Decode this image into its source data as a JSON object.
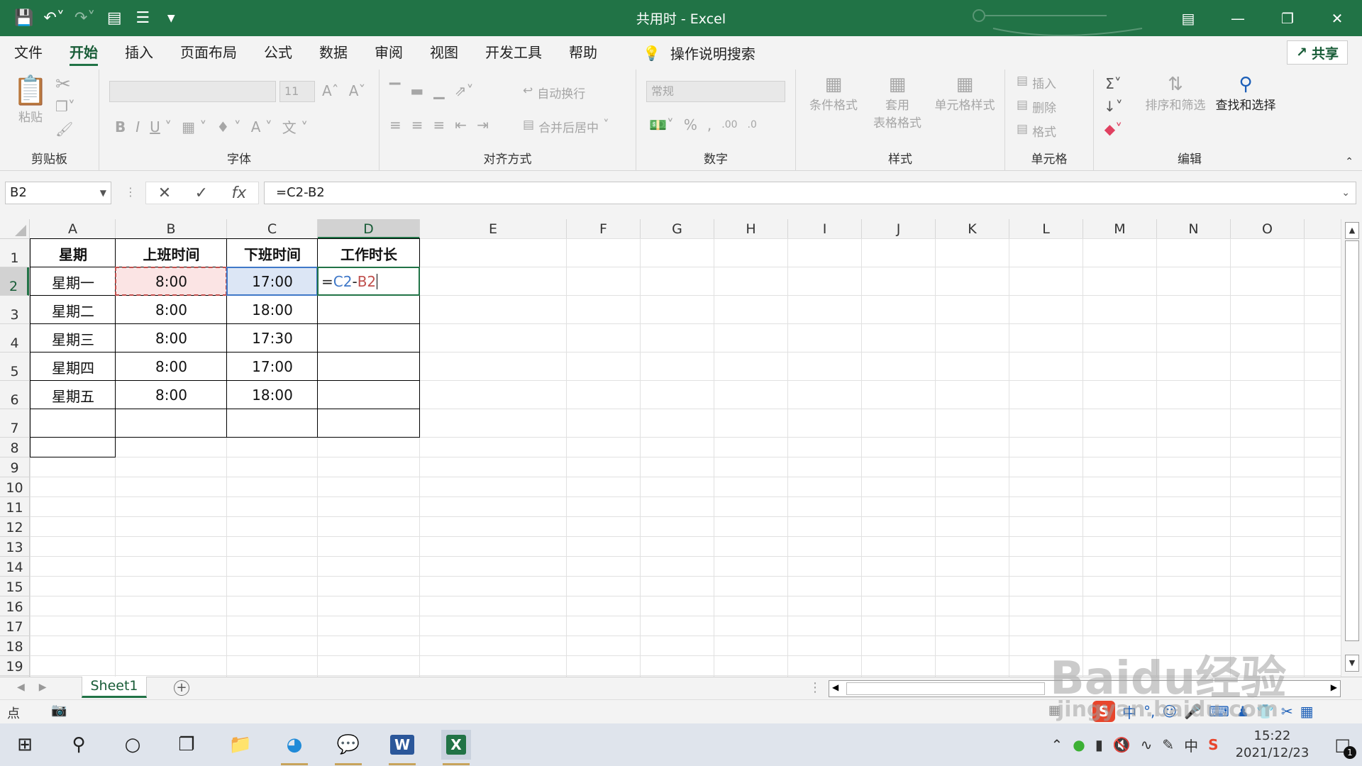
{
  "titlebar": {
    "title": "共用时  -  Excel",
    "qat_icons": [
      "save-icon",
      "undo-icon",
      "redo-icon",
      "form-icon",
      "align-icon",
      "customize-icon"
    ],
    "win_buttons": [
      "ribbon-display-icon",
      "minimize-icon",
      "restore-icon",
      "close-icon"
    ]
  },
  "menu": {
    "tabs": [
      "文件",
      "开始",
      "插入",
      "页面布局",
      "公式",
      "数据",
      "审阅",
      "视图",
      "开发工具",
      "帮助"
    ],
    "active_tab": "开始",
    "search_label": "操作说明搜索",
    "share_label": "共享"
  },
  "ribbon": {
    "clipboard": {
      "paste": "粘贴",
      "label": "剪贴板"
    },
    "font": {
      "font_name": "",
      "font_size": "11",
      "label": "字体"
    },
    "alignment": {
      "wrap": "自动换行",
      "merge": "合并后居中",
      "label": "对齐方式"
    },
    "number": {
      "format": "常规",
      "label": "数字"
    },
    "styles": {
      "conditional": "条件格式",
      "table_line1": "套用",
      "table_line2": "表格格式",
      "cell_styles": "单元格样式",
      "label": "样式"
    },
    "cells": {
      "insert": "插入",
      "delete": "删除",
      "format": "格式",
      "label": "单元格"
    },
    "editing": {
      "sort": "排序和筛选",
      "find": "查找和选择",
      "label": "编辑"
    }
  },
  "formula_bar": {
    "name_box": "B2",
    "formula": "=C2-B2"
  },
  "sheet": {
    "columns": [
      "A",
      "B",
      "C",
      "D",
      "E",
      "F",
      "G",
      "H",
      "I",
      "J",
      "K",
      "L",
      "M",
      "N",
      "O"
    ],
    "rows": [
      "1",
      "2",
      "3",
      "4",
      "5",
      "6",
      "7",
      "8",
      "9",
      "10",
      "11",
      "12",
      "13",
      "14",
      "15",
      "16",
      "17",
      "18",
      "19"
    ],
    "selected_column": "D",
    "selected_row": "2",
    "headers": [
      "星期",
      "上班时间",
      "下班时间",
      "工作时长"
    ],
    "data": [
      [
        "星期一",
        "8:00",
        "17:00",
        ""
      ],
      [
        "星期二",
        "8:00",
        "18:00",
        ""
      ],
      [
        "星期三",
        "8:00",
        "17:30",
        ""
      ],
      [
        "星期四",
        "8:00",
        "17:00",
        ""
      ],
      [
        "星期五",
        "8:00",
        "18:00",
        ""
      ]
    ],
    "editing_cell": {
      "ref": "D2",
      "parts": {
        "eq": "=",
        "ref1": "C2",
        "op": "-",
        "ref2": "B2"
      }
    },
    "ref_colors": {
      "C2": "#3f78c8",
      "B2": "#c0504d"
    }
  },
  "sheet_tabs": {
    "active": "Sheet1"
  },
  "status": {
    "mode": "点"
  },
  "ime": {
    "lang": "中"
  },
  "taskbar": {
    "time": "15:22",
    "date": "2021/12/23",
    "tray_lang": "中",
    "notification_count": "1"
  },
  "watermark": {
    "main": "Baidu经验",
    "sub": "jingyan.baidu.com"
  },
  "colors": {
    "excel_green": "#217346",
    "active_tab_text": "#185c37"
  }
}
